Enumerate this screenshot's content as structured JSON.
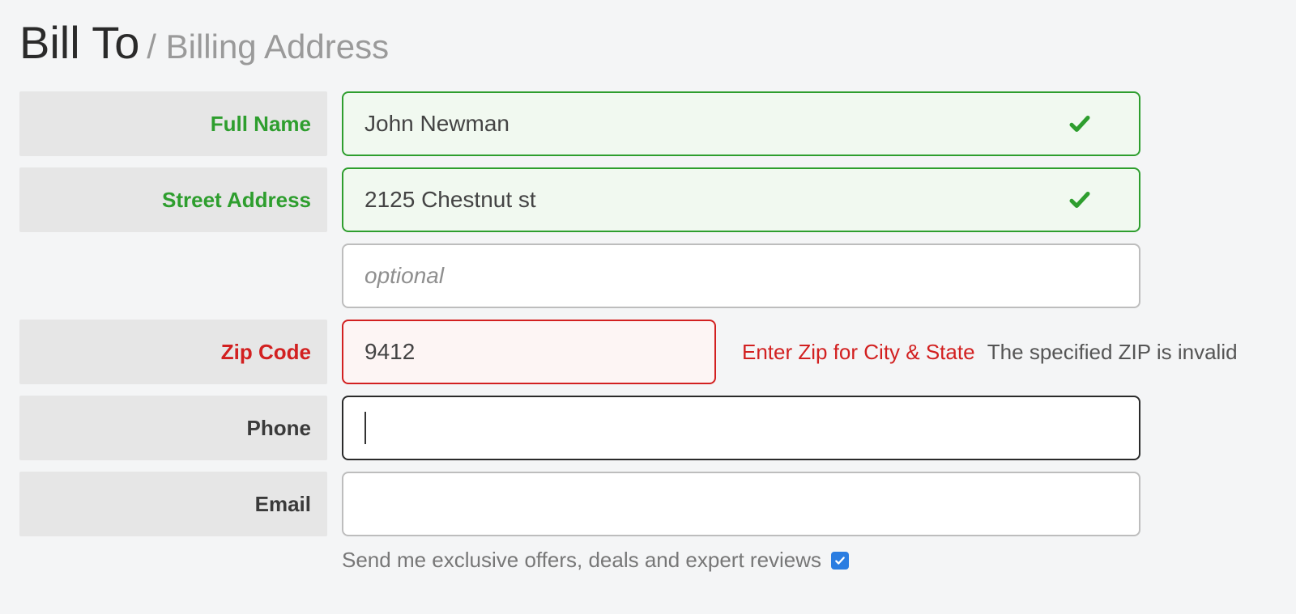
{
  "heading": {
    "main": "Bill To",
    "sub": "/ Billing Address"
  },
  "fields": {
    "full_name": {
      "label": "Full Name",
      "value": "John Newman",
      "state": "valid"
    },
    "street": {
      "label": "Street Address",
      "value": "2125 Chestnut st",
      "state": "valid"
    },
    "street2": {
      "placeholder": "optional",
      "value": ""
    },
    "zip": {
      "label": "Zip Code",
      "value": "9412",
      "state": "error",
      "hint": "Enter Zip for City & State",
      "error_msg": "The specified ZIP is invalid"
    },
    "phone": {
      "label": "Phone",
      "value": "",
      "state": "active"
    },
    "email": {
      "label": "Email",
      "value": ""
    }
  },
  "optin": {
    "text": "Send me exclusive offers, deals and expert reviews",
    "checked": true
  }
}
